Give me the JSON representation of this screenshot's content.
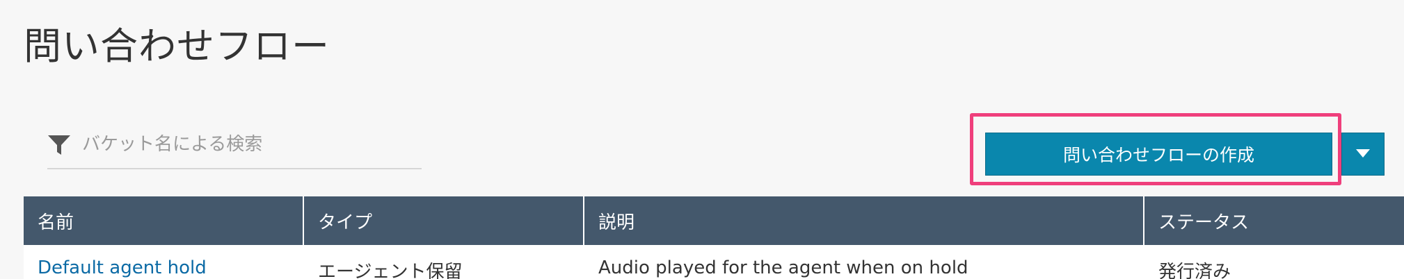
{
  "page": {
    "title": "問い合わせフロー"
  },
  "search": {
    "placeholder": "バケット名による検索",
    "value": "",
    "icon": "filter-icon"
  },
  "actions": {
    "create_label": "問い合わせフローの作成",
    "dropdown_icon": "caret-down-icon",
    "highlight_color": "#ef3f7c",
    "button_color": "#0a87ad"
  },
  "table": {
    "header_color": "#44586c",
    "columns": [
      "名前",
      "タイプ",
      "説明",
      "ステータス"
    ],
    "rows": [
      {
        "name": "Default agent hold",
        "type": "エージェント保留",
        "description": "Audio played for the agent when on hold",
        "status": "発行済み"
      }
    ]
  }
}
